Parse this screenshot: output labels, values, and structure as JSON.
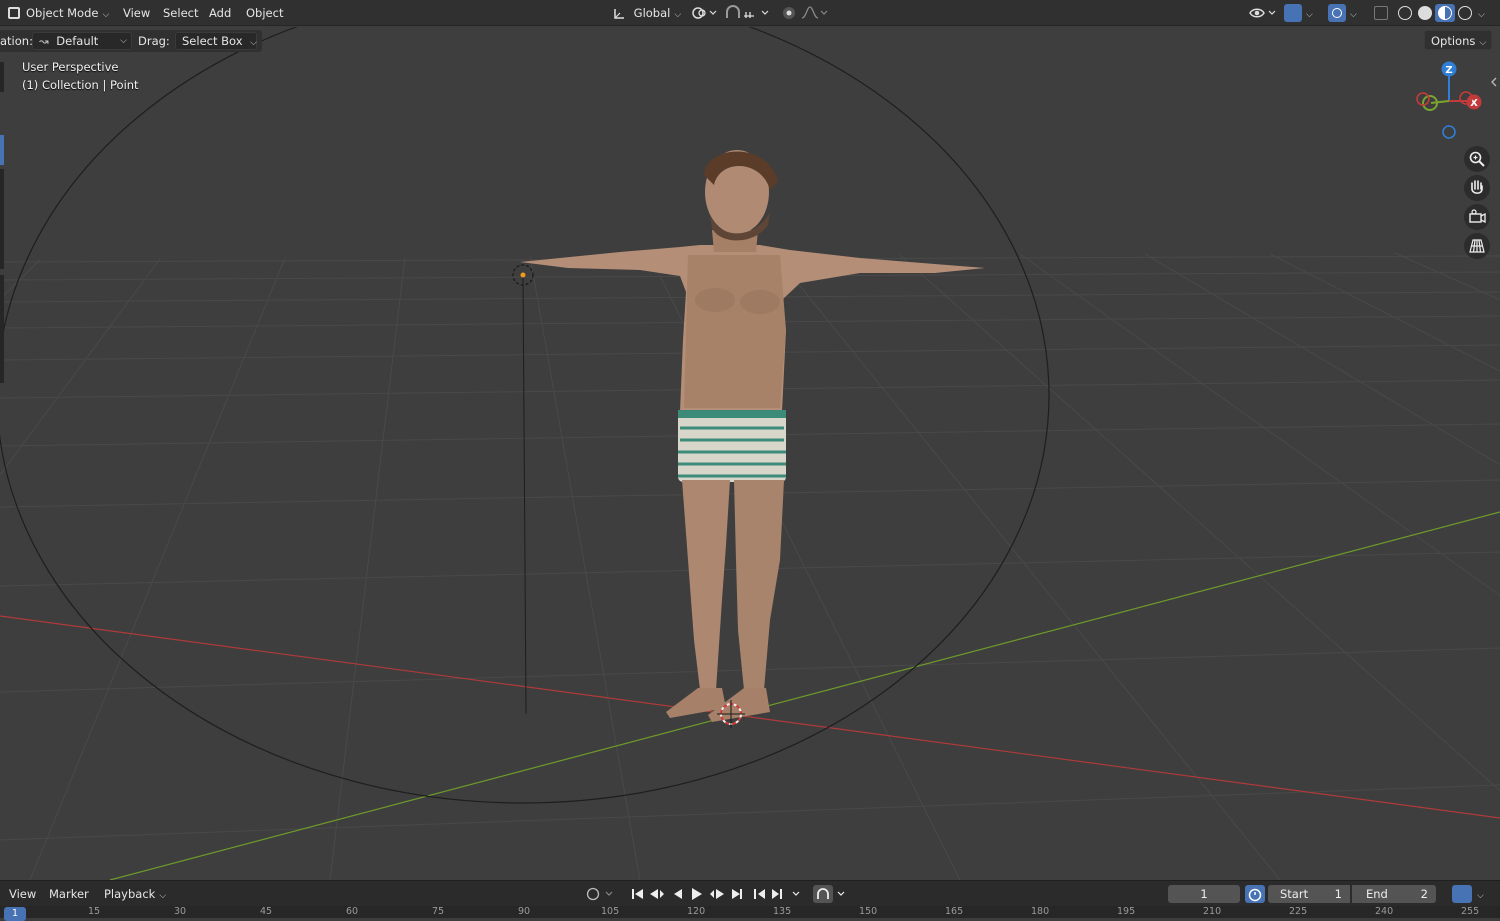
{
  "header": {
    "mode_label": "Object Mode",
    "menus": [
      "View",
      "Select",
      "Add",
      "Object"
    ],
    "transform_orientation": "Global"
  },
  "tool_header": {
    "orientation_prefix": "ation:",
    "orientation_value": "Default",
    "drag_label": "Drag:",
    "drag_value": "Select Box",
    "options_label": "Options"
  },
  "viewport": {
    "perspective_label": "User Perspective",
    "collection_label": "(1) Collection | Point",
    "gizmo": {
      "z": "Z",
      "x": "X"
    }
  },
  "timeline": {
    "menus": {
      "view": "View",
      "marker": "Marker",
      "playback": "Playback"
    },
    "current_frame": "1",
    "start_label": "Start",
    "start_value": "1",
    "end_label": "End",
    "end_value": "2",
    "ruler_current": "1",
    "ruler_ticks": [
      "15",
      "30",
      "45",
      "60",
      "75",
      "90",
      "105",
      "120",
      "135",
      "150",
      "165",
      "180",
      "195",
      "210",
      "225",
      "240",
      "255"
    ]
  },
  "colors": {
    "accent": "#4772b3",
    "x_axis": "#c43a3a",
    "y_axis": "#7aa52e",
    "z_axis": "#2f7fd6"
  }
}
